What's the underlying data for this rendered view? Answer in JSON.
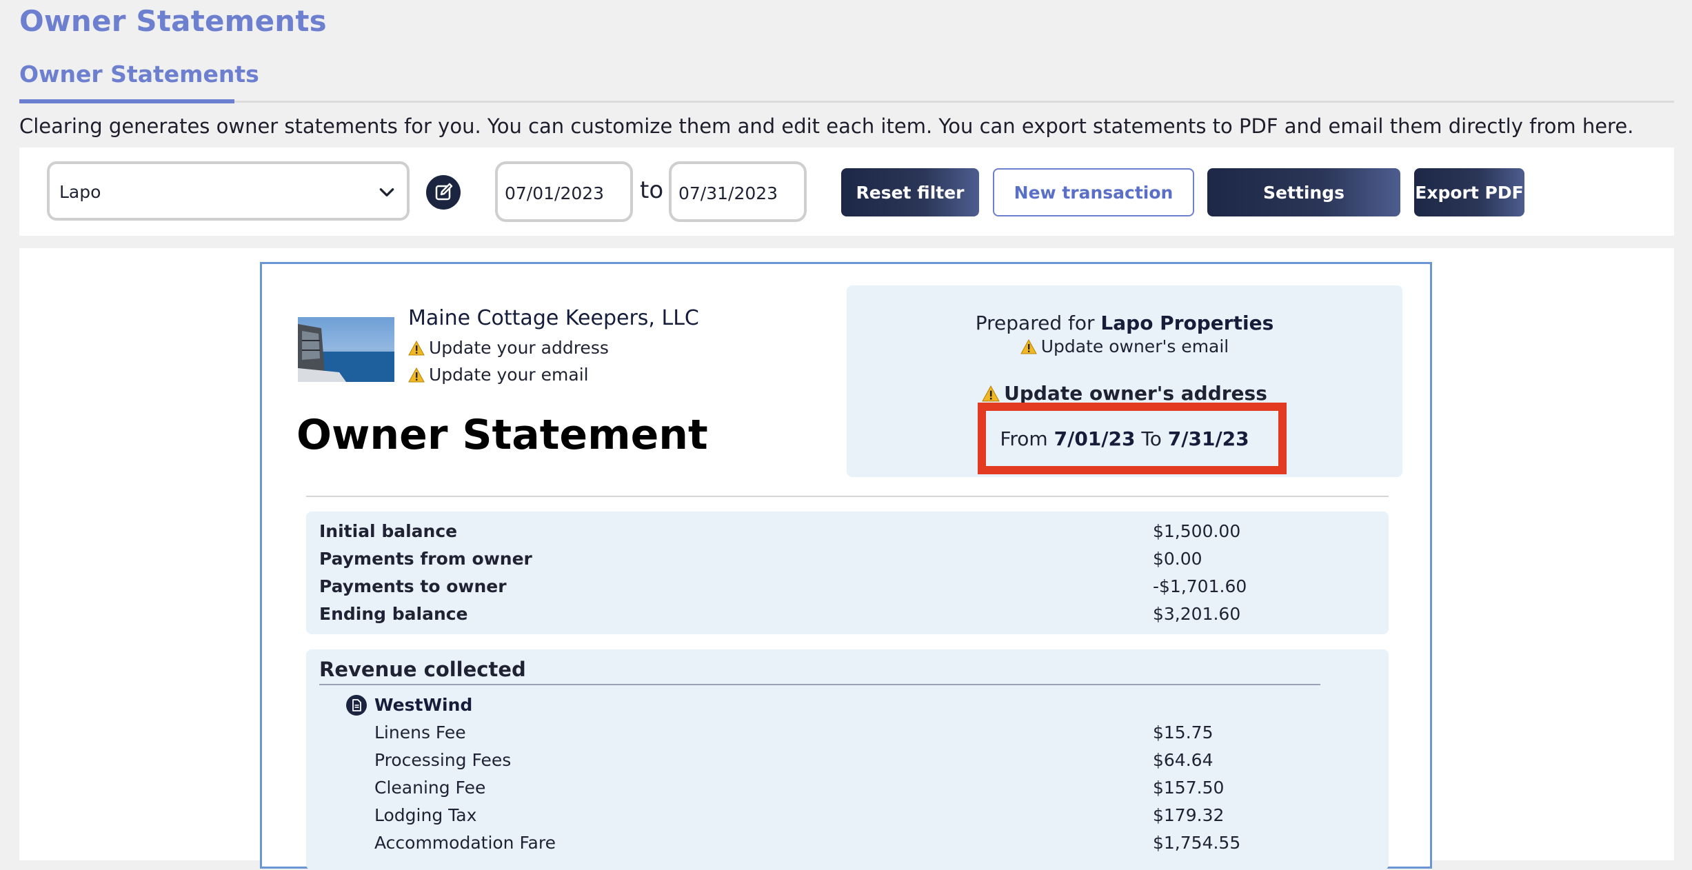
{
  "header": {
    "page_title": "Owner Statements",
    "tab_label": "Owner Statements",
    "description": "Clearing generates owner statements for you. You can customize them and edit each item. You can export statements to PDF and email them directly from here."
  },
  "filters": {
    "owner_selected": "Lapo",
    "date_from": "07/01/2023",
    "date_separator": "to",
    "date_to": "07/31/2023",
    "buttons": {
      "reset": "Reset filter",
      "new_transaction": "New transaction",
      "settings": "Settings",
      "export_pdf": "Export PDF"
    }
  },
  "statement": {
    "company_name": "Maine Cottage Keepers, LLC",
    "warnings": {
      "address": "Update your address",
      "email": "Update your email"
    },
    "title": "Owner Statement",
    "prepared_for_prefix": "Prepared for",
    "prepared_for_name": "Lapo Properties",
    "owner_email_warning": "Update owner's email",
    "owner_address_warning": "Update owner's address",
    "period": {
      "from_label": "From",
      "from_date": "7/01/23",
      "to_label": "To",
      "to_date": "7/31/23"
    },
    "balances": [
      {
        "label": "Initial balance",
        "value": "$1,500.00"
      },
      {
        "label": "Payments from owner",
        "value": "$0.00"
      },
      {
        "label": "Payments to owner",
        "value": "-$1,701.60"
      },
      {
        "label": "Ending balance",
        "value": "$3,201.60"
      }
    ],
    "revenue": {
      "title": "Revenue collected",
      "listing": "WestWind",
      "items": [
        {
          "label": "Linens Fee",
          "value": "$15.75"
        },
        {
          "label": "Processing Fees",
          "value": "$64.64"
        },
        {
          "label": "Cleaning Fee",
          "value": "$157.50"
        },
        {
          "label": "Lodging Tax",
          "value": "$179.32"
        },
        {
          "label": "Accommodation Fare",
          "value": "$1,754.55"
        }
      ]
    }
  },
  "colors": {
    "accent": "#6d7fcf",
    "dark_button": "#1d2746",
    "panel_bg": "#e9f1f9",
    "highlight": "#e33a22"
  }
}
